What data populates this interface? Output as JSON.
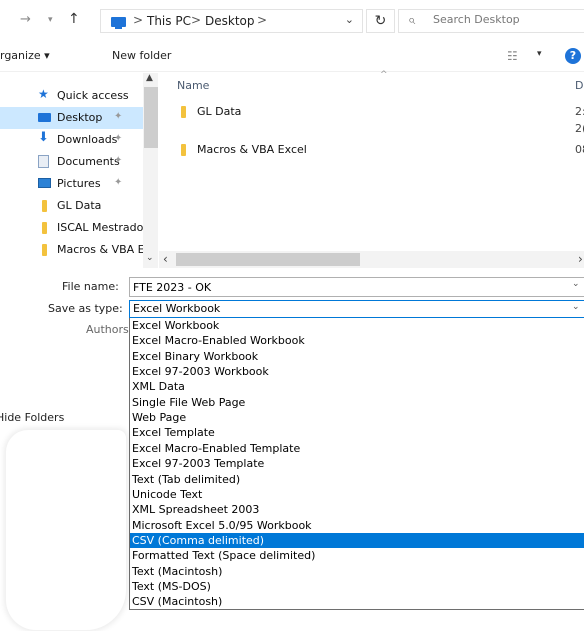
{
  "address_bar": {
    "crumbs": [
      "This PC",
      "Desktop"
    ],
    "separator": ">",
    "search_placeholder": "Search Desktop"
  },
  "toolbar": {
    "organize_label": "rganize ▾",
    "new_folder_label": "New folder"
  },
  "nav_pane": {
    "items": [
      {
        "label": "Quick access",
        "icon": "star-icon",
        "pinned": false
      },
      {
        "label": "Desktop",
        "icon": "desktop-icon",
        "pinned": true,
        "selected": true
      },
      {
        "label": "Downloads",
        "icon": "download-icon",
        "pinned": true
      },
      {
        "label": "Documents",
        "icon": "document-icon",
        "pinned": true
      },
      {
        "label": "Pictures",
        "icon": "pictures-icon",
        "pinned": true
      },
      {
        "label": "GL Data",
        "icon": "folder-icon",
        "pinned": false
      },
      {
        "label": "ISCAL Mestrado",
        "icon": "folder-icon",
        "pinned": false
      },
      {
        "label": "Macros & VBA E:",
        "icon": "folder-icon",
        "pinned": false
      }
    ]
  },
  "file_list": {
    "column_name": "Name",
    "column_date": "D",
    "files": [
      {
        "name": "GL Data",
        "date": "2:",
        "date_line2": "2("
      },
      {
        "name": "Macros & VBA Excel",
        "date": "08"
      }
    ]
  },
  "form": {
    "file_name_label": "File name:",
    "file_name_value": "FTE 2023 - OK",
    "save_as_type_label": "Save as type:",
    "save_as_type_value": "Excel Workbook",
    "authors_label": "Authors:",
    "hide_folders_label": "Hide Folders"
  },
  "save_types": [
    "Excel Workbook",
    "Excel Macro-Enabled Workbook",
    "Excel Binary Workbook",
    "Excel 97-2003 Workbook",
    "XML Data",
    "Single File Web Page",
    "Web Page",
    "Excel Template",
    "Excel Macro-Enabled Template",
    "Excel 97-2003 Template",
    "Text (Tab delimited)",
    "Unicode Text",
    "XML Spreadsheet 2003",
    "Microsoft Excel 5.0/95 Workbook",
    "CSV (Comma delimited)",
    "Formatted Text (Space delimited)",
    "Text (Macintosh)",
    "Text (MS-DOS)",
    "CSV (Macintosh)"
  ],
  "selected_save_type_index": 14,
  "colors": {
    "accent": "#0078d7",
    "nav_selected": "#cce8ff",
    "folder": "#f3c23d"
  }
}
